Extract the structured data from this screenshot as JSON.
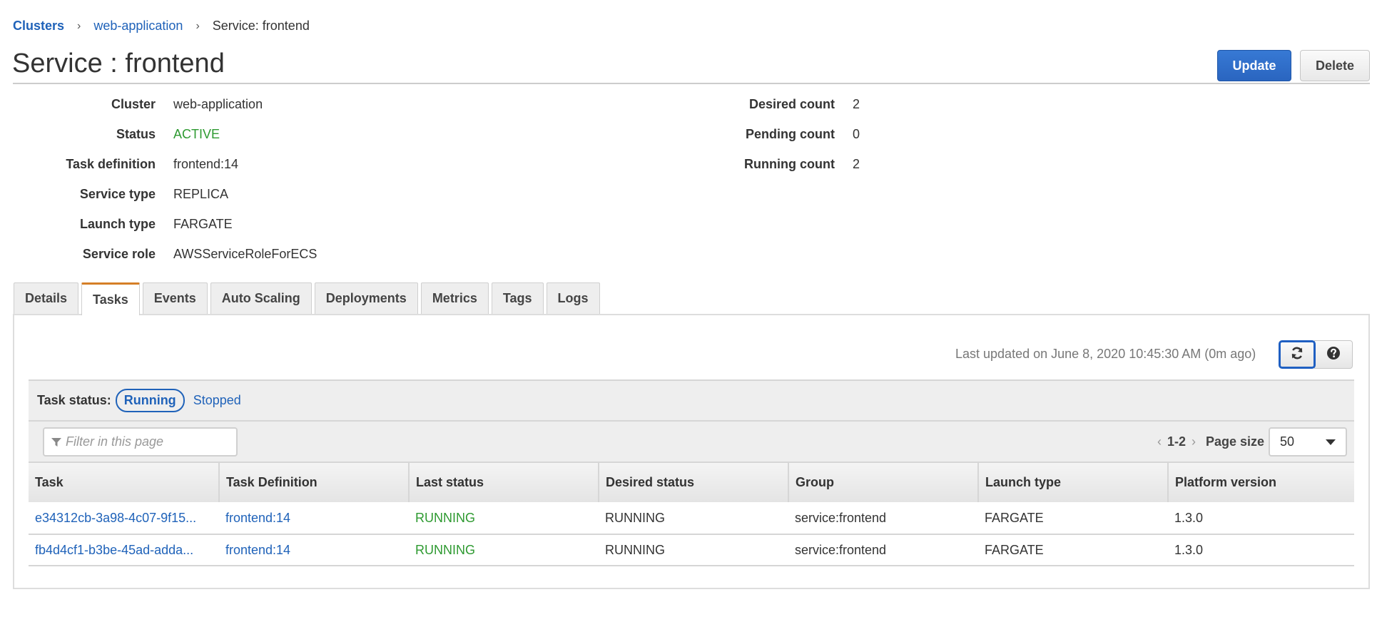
{
  "breadcrumb": {
    "items": [
      {
        "label": "Clusters",
        "link": true
      },
      {
        "label": "web-application",
        "link": true
      },
      {
        "label": "Service: frontend",
        "link": false
      }
    ],
    "separator": "›"
  },
  "header": {
    "title": "Service : frontend",
    "update_label": "Update",
    "delete_label": "Delete"
  },
  "details": {
    "left": [
      {
        "key": "Cluster",
        "value": "web-application",
        "type": "link"
      },
      {
        "key": "Status",
        "value": "ACTIVE",
        "type": "status"
      },
      {
        "key": "Task definition",
        "value": "frontend:14",
        "type": "link"
      },
      {
        "key": "Service type",
        "value": "REPLICA",
        "type": "text"
      },
      {
        "key": "Launch type",
        "value": "FARGATE",
        "type": "text"
      },
      {
        "key": "Service role",
        "value": "AWSServiceRoleForECS",
        "type": "text"
      }
    ],
    "right": [
      {
        "key": "Desired count",
        "value": "2"
      },
      {
        "key": "Pending count",
        "value": "0"
      },
      {
        "key": "Running count",
        "value": "2"
      }
    ]
  },
  "tabs": [
    {
      "label": "Details",
      "active": false
    },
    {
      "label": "Tasks",
      "active": true
    },
    {
      "label": "Events",
      "active": false
    },
    {
      "label": "Auto Scaling",
      "active": false
    },
    {
      "label": "Deployments",
      "active": false
    },
    {
      "label": "Metrics",
      "active": false
    },
    {
      "label": "Tags",
      "active": false
    },
    {
      "label": "Logs",
      "active": false
    }
  ],
  "tasks_panel": {
    "last_updated": "Last updated on June 8, 2020 10:45:30 AM (0m ago)",
    "refresh_icon": "refresh-icon",
    "help_icon": "help-icon",
    "status_label": "Task status:",
    "status_running": "Running",
    "status_stopped": "Stopped",
    "filter_placeholder": "Filter in this page",
    "filter_value": "",
    "pager": {
      "prev": "‹",
      "range": "1-2",
      "next": "›",
      "page_size_label": "Page size",
      "page_size_value": "50"
    },
    "table": {
      "columns": [
        "Task",
        "Task Definition",
        "Last status",
        "Desired status",
        "Group",
        "Launch type",
        "Platform version"
      ],
      "rows": [
        [
          "e34312cb-3a98-4c07-9f15...",
          "frontend:14",
          "RUNNING",
          "RUNNING",
          "service:frontend",
          "FARGATE",
          "1.3.0"
        ],
        [
          "fb4d4cf1-b3be-45ad-adda...",
          "frontend:14",
          "RUNNING",
          "RUNNING",
          "service:frontend",
          "FARGATE",
          "1.3.0"
        ]
      ]
    }
  },
  "colors": {
    "link": "#1f62b9",
    "status_green": "#2e9a31",
    "primary_button": "#2a65c0",
    "active_tab_accent": "#d57f27"
  }
}
